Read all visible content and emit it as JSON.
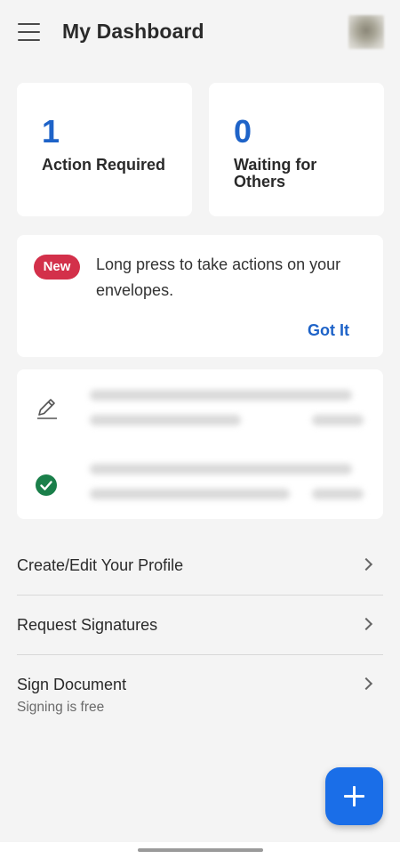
{
  "header": {
    "title": "My Dashboard",
    "menu_icon": "hamburger-menu-icon",
    "avatar": "user-avatar"
  },
  "stats": {
    "action_required": {
      "count": "1",
      "label": "Action Required"
    },
    "waiting_for_others": {
      "count": "0",
      "label": "Waiting for Others"
    }
  },
  "tip": {
    "badge": "New",
    "text": "Long press to take actions on your envelopes.",
    "action": "Got It"
  },
  "envelopes": [
    {
      "status_icon": "pencil-icon"
    },
    {
      "status_icon": "check-circle-icon"
    }
  ],
  "menu": [
    {
      "label": "Create/Edit Your Profile"
    },
    {
      "label": "Request Signatures"
    },
    {
      "label": "Sign Document",
      "subtitle": "Signing is free"
    }
  ],
  "fab": {
    "icon": "plus-icon"
  },
  "colors": {
    "accent": "#1e63c8",
    "fab": "#1a6ee8",
    "badge": "#d3304a",
    "completed": "#1a7f4a",
    "background": "#f4f4f4"
  }
}
